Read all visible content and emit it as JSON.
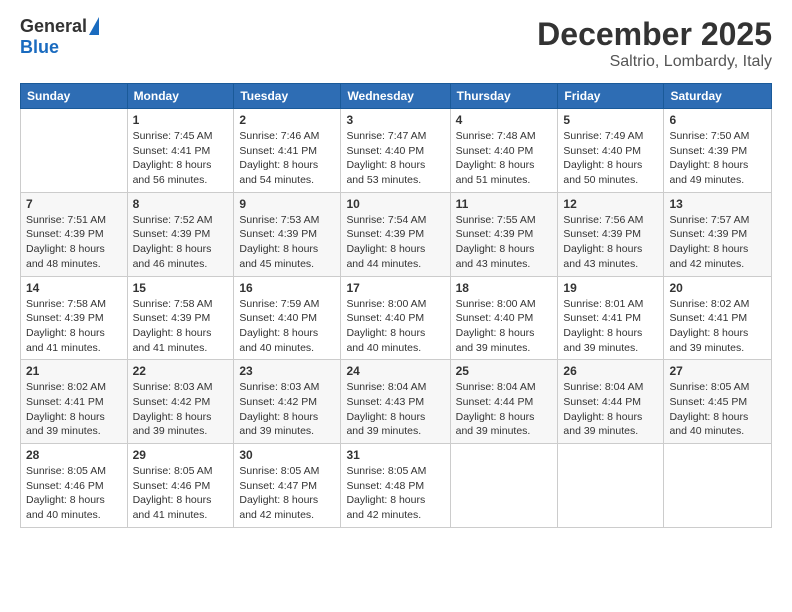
{
  "header": {
    "logo_general": "General",
    "logo_blue": "Blue",
    "month_title": "December 2025",
    "location": "Saltrio, Lombardy, Italy"
  },
  "calendar": {
    "days_of_week": [
      "Sunday",
      "Monday",
      "Tuesday",
      "Wednesday",
      "Thursday",
      "Friday",
      "Saturday"
    ],
    "weeks": [
      [
        {
          "day": "",
          "content": ""
        },
        {
          "day": "1",
          "content": "Sunrise: 7:45 AM\nSunset: 4:41 PM\nDaylight: 8 hours\nand 56 minutes."
        },
        {
          "day": "2",
          "content": "Sunrise: 7:46 AM\nSunset: 4:41 PM\nDaylight: 8 hours\nand 54 minutes."
        },
        {
          "day": "3",
          "content": "Sunrise: 7:47 AM\nSunset: 4:40 PM\nDaylight: 8 hours\nand 53 minutes."
        },
        {
          "day": "4",
          "content": "Sunrise: 7:48 AM\nSunset: 4:40 PM\nDaylight: 8 hours\nand 51 minutes."
        },
        {
          "day": "5",
          "content": "Sunrise: 7:49 AM\nSunset: 4:40 PM\nDaylight: 8 hours\nand 50 minutes."
        },
        {
          "day": "6",
          "content": "Sunrise: 7:50 AM\nSunset: 4:39 PM\nDaylight: 8 hours\nand 49 minutes."
        }
      ],
      [
        {
          "day": "7",
          "content": "Sunrise: 7:51 AM\nSunset: 4:39 PM\nDaylight: 8 hours\nand 48 minutes."
        },
        {
          "day": "8",
          "content": "Sunrise: 7:52 AM\nSunset: 4:39 PM\nDaylight: 8 hours\nand 46 minutes."
        },
        {
          "day": "9",
          "content": "Sunrise: 7:53 AM\nSunset: 4:39 PM\nDaylight: 8 hours\nand 45 minutes."
        },
        {
          "day": "10",
          "content": "Sunrise: 7:54 AM\nSunset: 4:39 PM\nDaylight: 8 hours\nand 44 minutes."
        },
        {
          "day": "11",
          "content": "Sunrise: 7:55 AM\nSunset: 4:39 PM\nDaylight: 8 hours\nand 43 minutes."
        },
        {
          "day": "12",
          "content": "Sunrise: 7:56 AM\nSunset: 4:39 PM\nDaylight: 8 hours\nand 43 minutes."
        },
        {
          "day": "13",
          "content": "Sunrise: 7:57 AM\nSunset: 4:39 PM\nDaylight: 8 hours\nand 42 minutes."
        }
      ],
      [
        {
          "day": "14",
          "content": "Sunrise: 7:58 AM\nSunset: 4:39 PM\nDaylight: 8 hours\nand 41 minutes."
        },
        {
          "day": "15",
          "content": "Sunrise: 7:58 AM\nSunset: 4:39 PM\nDaylight: 8 hours\nand 41 minutes."
        },
        {
          "day": "16",
          "content": "Sunrise: 7:59 AM\nSunset: 4:40 PM\nDaylight: 8 hours\nand 40 minutes."
        },
        {
          "day": "17",
          "content": "Sunrise: 8:00 AM\nSunset: 4:40 PM\nDaylight: 8 hours\nand 40 minutes."
        },
        {
          "day": "18",
          "content": "Sunrise: 8:00 AM\nSunset: 4:40 PM\nDaylight: 8 hours\nand 39 minutes."
        },
        {
          "day": "19",
          "content": "Sunrise: 8:01 AM\nSunset: 4:41 PM\nDaylight: 8 hours\nand 39 minutes."
        },
        {
          "day": "20",
          "content": "Sunrise: 8:02 AM\nSunset: 4:41 PM\nDaylight: 8 hours\nand 39 minutes."
        }
      ],
      [
        {
          "day": "21",
          "content": "Sunrise: 8:02 AM\nSunset: 4:41 PM\nDaylight: 8 hours\nand 39 minutes."
        },
        {
          "day": "22",
          "content": "Sunrise: 8:03 AM\nSunset: 4:42 PM\nDaylight: 8 hours\nand 39 minutes."
        },
        {
          "day": "23",
          "content": "Sunrise: 8:03 AM\nSunset: 4:42 PM\nDaylight: 8 hours\nand 39 minutes."
        },
        {
          "day": "24",
          "content": "Sunrise: 8:04 AM\nSunset: 4:43 PM\nDaylight: 8 hours\nand 39 minutes."
        },
        {
          "day": "25",
          "content": "Sunrise: 8:04 AM\nSunset: 4:44 PM\nDaylight: 8 hours\nand 39 minutes."
        },
        {
          "day": "26",
          "content": "Sunrise: 8:04 AM\nSunset: 4:44 PM\nDaylight: 8 hours\nand 39 minutes."
        },
        {
          "day": "27",
          "content": "Sunrise: 8:05 AM\nSunset: 4:45 PM\nDaylight: 8 hours\nand 40 minutes."
        }
      ],
      [
        {
          "day": "28",
          "content": "Sunrise: 8:05 AM\nSunset: 4:46 PM\nDaylight: 8 hours\nand 40 minutes."
        },
        {
          "day": "29",
          "content": "Sunrise: 8:05 AM\nSunset: 4:46 PM\nDaylight: 8 hours\nand 41 minutes."
        },
        {
          "day": "30",
          "content": "Sunrise: 8:05 AM\nSunset: 4:47 PM\nDaylight: 8 hours\nand 42 minutes."
        },
        {
          "day": "31",
          "content": "Sunrise: 8:05 AM\nSunset: 4:48 PM\nDaylight: 8 hours\nand 42 minutes."
        },
        {
          "day": "",
          "content": ""
        },
        {
          "day": "",
          "content": ""
        },
        {
          "day": "",
          "content": ""
        }
      ]
    ]
  }
}
